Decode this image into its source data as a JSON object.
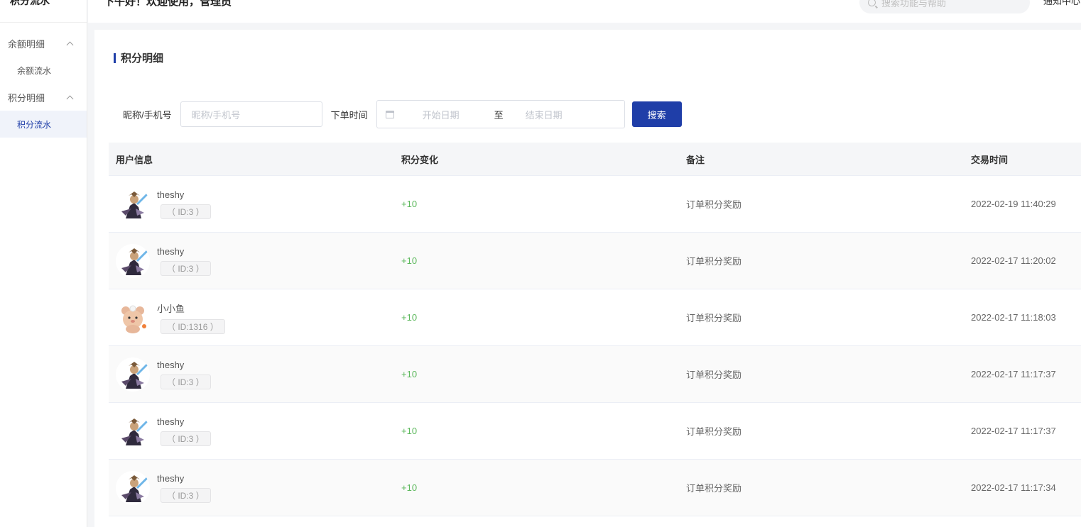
{
  "sidebar": {
    "title": "积分流水",
    "groups": [
      {
        "label": "余额明细",
        "items": [
          {
            "label": "余额流水"
          }
        ]
      },
      {
        "label": "积分明细",
        "items": [
          {
            "label": "积分流水"
          }
        ]
      }
    ]
  },
  "topbar": {
    "greeting": "下午好！欢迎使用，管理员",
    "search_placeholder": "搜索功能与帮助",
    "notice": "通知中心"
  },
  "page": {
    "title": "积分明细"
  },
  "filter": {
    "name_label": "昵称/手机号",
    "name_placeholder": "昵称/手机号",
    "time_label": "下单时间",
    "start_placeholder": "开始日期",
    "separator": "至",
    "end_placeholder": "结束日期",
    "search_button": "搜索"
  },
  "table": {
    "headers": [
      "用户信息",
      "积分变化",
      "备注",
      "交易时间"
    ],
    "rows": [
      {
        "name": "theshy",
        "id": "（ ID:3 ）",
        "points": "+10",
        "remark": "订单积分奖励",
        "time": "2022-02-19 11:40:29",
        "avatar": "warrior"
      },
      {
        "name": "theshy",
        "id": "（ ID:3 ）",
        "points": "+10",
        "remark": "订单积分奖励",
        "time": "2022-02-17 11:20:02",
        "avatar": "warrior"
      },
      {
        "name": "小小鱼",
        "id": "（ ID:1316 ）",
        "points": "+10",
        "remark": "订单积分奖励",
        "time": "2022-02-17 11:18:03",
        "avatar": "bear"
      },
      {
        "name": "theshy",
        "id": "（ ID:3 ）",
        "points": "+10",
        "remark": "订单积分奖励",
        "time": "2022-02-17 11:17:37",
        "avatar": "warrior"
      },
      {
        "name": "theshy",
        "id": "（ ID:3 ）",
        "points": "+10",
        "remark": "订单积分奖励",
        "time": "2022-02-17 11:17:37",
        "avatar": "warrior"
      },
      {
        "name": "theshy",
        "id": "（ ID:3 ）",
        "points": "+10",
        "remark": "订单积分奖励",
        "time": "2022-02-17 11:17:34",
        "avatar": "warrior"
      }
    ]
  },
  "colors": {
    "accent": "#1f3ea8",
    "points_positive": "#5cb85c"
  }
}
